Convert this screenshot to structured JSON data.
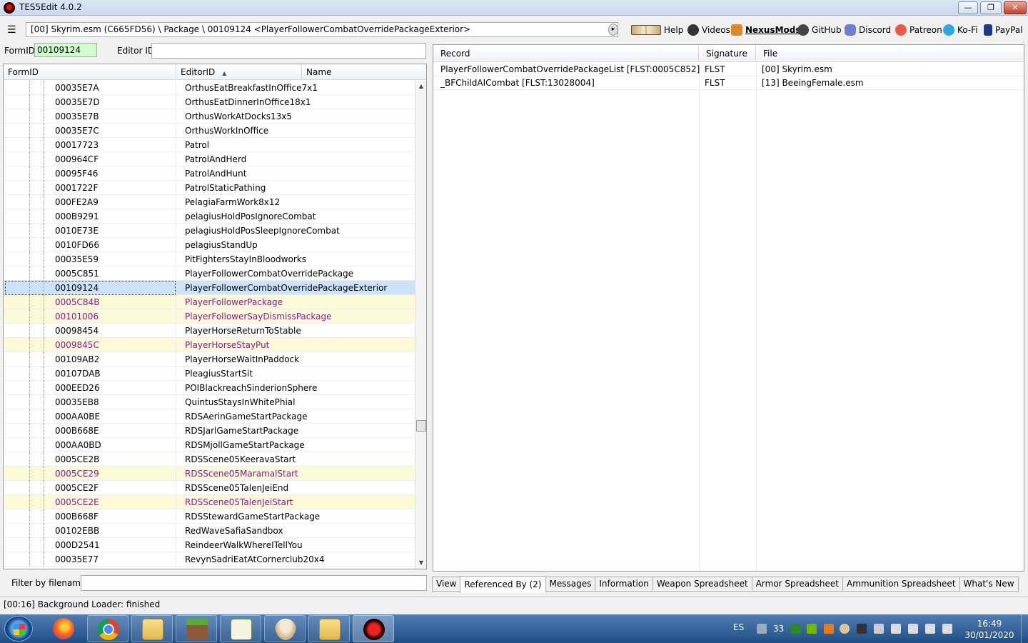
{
  "window": {
    "title": "TES5Edit 4.0.2",
    "controls": {
      "minimize": "—",
      "maximize": "❐",
      "close": "✕"
    }
  },
  "toolbar": {
    "path": "[00] Skyrim.esm (C665FD56) \\ Package \\ 00109124 <PlayerFollowerCombatOverridePackageExterior>",
    "links": [
      {
        "label": "Help",
        "icon": "book-icon"
      },
      {
        "label": "Videos",
        "icon": "gp-icon"
      },
      {
        "label": "NexusMods",
        "icon": "nexus-icon"
      },
      {
        "label": "GitHub",
        "icon": "github-icon"
      },
      {
        "label": "Discord",
        "icon": "discord-icon"
      },
      {
        "label": "Patreon",
        "icon": "patreon-icon"
      },
      {
        "label": "Ko-Fi",
        "icon": "kofi-icon"
      },
      {
        "label": "PayPal",
        "icon": "paypal-icon"
      }
    ]
  },
  "search": {
    "formid_label": "FormID",
    "formid_value": "00109124",
    "editorid_label": "Editor ID",
    "editorid_value": ""
  },
  "tree": {
    "columns": [
      "FormID",
      "EditorID",
      "Name"
    ],
    "sort_indicator": "▲",
    "rows": [
      {
        "formid": "00035E7A",
        "editorid": "OrthusEatBreakfastInOffice7x1",
        "state": "normal"
      },
      {
        "formid": "00035E7D",
        "editorid": "OrthusEatDinnerInOffice18x1",
        "state": "normal"
      },
      {
        "formid": "00035E7B",
        "editorid": "OrthusWorkAtDocks13x5",
        "state": "normal"
      },
      {
        "formid": "00035E7C",
        "editorid": "OrthusWorkInOffice",
        "state": "normal"
      },
      {
        "formid": "00017723",
        "editorid": "Patrol",
        "state": "normal"
      },
      {
        "formid": "000964CF",
        "editorid": "PatrolAndHerd",
        "state": "normal"
      },
      {
        "formid": "00095F46",
        "editorid": "PatrolAndHunt",
        "state": "normal"
      },
      {
        "formid": "0001722F",
        "editorid": "PatrolStaticPathing",
        "state": "normal"
      },
      {
        "formid": "000FE2A9",
        "editorid": "PelagiaFarmWork8x12",
        "state": "normal"
      },
      {
        "formid": "000B9291",
        "editorid": "pelagiusHoldPosIgnoreCombat",
        "state": "normal"
      },
      {
        "formid": "0010E73E",
        "editorid": "pelagiusHoldPosSleepIgnoreCombat",
        "state": "normal"
      },
      {
        "formid": "0010FD66",
        "editorid": "pelagiusStandUp",
        "state": "normal"
      },
      {
        "formid": "00035E59",
        "editorid": "PitFightersStayInBloodworks",
        "state": "normal"
      },
      {
        "formid": "0005C851",
        "editorid": "PlayerFollowerCombatOverridePackage",
        "state": "normal"
      },
      {
        "formid": "00109124",
        "editorid": "PlayerFollowerCombatOverridePackageExterior",
        "state": "selected"
      },
      {
        "formid": "0005C84B",
        "editorid": "PlayerFollowerPackage",
        "state": "highlight"
      },
      {
        "formid": "00101006",
        "editorid": "PlayerFollowerSayDismissPackage",
        "state": "highlight"
      },
      {
        "formid": "00098454",
        "editorid": "PlayerHorseReturnToStable",
        "state": "normal"
      },
      {
        "formid": "0009845C",
        "editorid": "PlayerHorseStayPut",
        "state": "highlight"
      },
      {
        "formid": "00109AB2",
        "editorid": "PlayerHorseWaitInPaddock",
        "state": "normal"
      },
      {
        "formid": "00107DAB",
        "editorid": "PleagiusStartSit",
        "state": "normal"
      },
      {
        "formid": "000EED26",
        "editorid": "POIBlackreachSinderionSphere",
        "state": "normal"
      },
      {
        "formid": "00035EB8",
        "editorid": "QuintusStaysInWhitePhial",
        "state": "normal"
      },
      {
        "formid": "000AA0BE",
        "editorid": "RDSAerinGameStartPackage",
        "state": "normal"
      },
      {
        "formid": "000B668E",
        "editorid": "RDSJarlGameStartPackage",
        "state": "normal"
      },
      {
        "formid": "000AA0BD",
        "editorid": "RDSMjollGameStartPackage",
        "state": "normal"
      },
      {
        "formid": "0005CE2B",
        "editorid": "RDSScene05KeeravaStart",
        "state": "normal"
      },
      {
        "formid": "0005CE29",
        "editorid": "RDSScene05MaramalStart",
        "state": "highlight"
      },
      {
        "formid": "0005CE2F",
        "editorid": "RDSScene05TalenJeiEnd",
        "state": "normal"
      },
      {
        "formid": "0005CE2E",
        "editorid": "RDSScene05TalenJeiStart",
        "state": "highlight"
      },
      {
        "formid": "000B668F",
        "editorid": "RDSStewardGameStartPackage",
        "state": "normal"
      },
      {
        "formid": "00102EBB",
        "editorid": "RedWaveSafiaSandbox",
        "state": "normal"
      },
      {
        "formid": "000D2541",
        "editorid": "ReindeerWalkWhereITellYou",
        "state": "normal"
      },
      {
        "formid": "00035E77",
        "editorid": "RevynSadriEatAtCornerclub20x4",
        "state": "normal"
      }
    ]
  },
  "filter": {
    "label": "Filter by filename:",
    "value": ""
  },
  "references": {
    "columns": [
      "Record",
      "Signature",
      "File"
    ],
    "rows": [
      {
        "record": "PlayerFollowerCombatOverridePackageList [FLST:0005C852]",
        "signature": "FLST",
        "file": "[00] Skyrim.esm"
      },
      {
        "record": "_BFChildAICombat [FLST:13028004]",
        "signature": "FLST",
        "file": "[13] BeeingFemale.esm"
      }
    ]
  },
  "tabs": [
    {
      "label": "View",
      "active": false
    },
    {
      "label": "Referenced By (2)",
      "active": true
    },
    {
      "label": "Messages",
      "active": false
    },
    {
      "label": "Information",
      "active": false
    },
    {
      "label": "Weapon Spreadsheet",
      "active": false
    },
    {
      "label": "Armor Spreadsheet",
      "active": false
    },
    {
      "label": "Ammunition Spreadsheet",
      "active": false
    },
    {
      "label": "What's New",
      "active": false
    }
  ],
  "status": {
    "text": "[00:16] Background Loader: finished"
  },
  "taskbar": {
    "apps": [
      "firefox-icon",
      "chrome-icon",
      "explorer-icon",
      "minecraft-icon",
      "notepad-icon",
      "tornado-icon",
      "folder-icon",
      "tes5edit-icon"
    ],
    "language": "ES",
    "tray_number": "33",
    "time": "16:49",
    "date": "30/01/2020"
  },
  "colors": {
    "highlight_text": "#8a1a8a",
    "highlight_bg": "#fdfbd7",
    "selected_bg": "#cce4fb",
    "formid_bg": "#cfffcf"
  }
}
